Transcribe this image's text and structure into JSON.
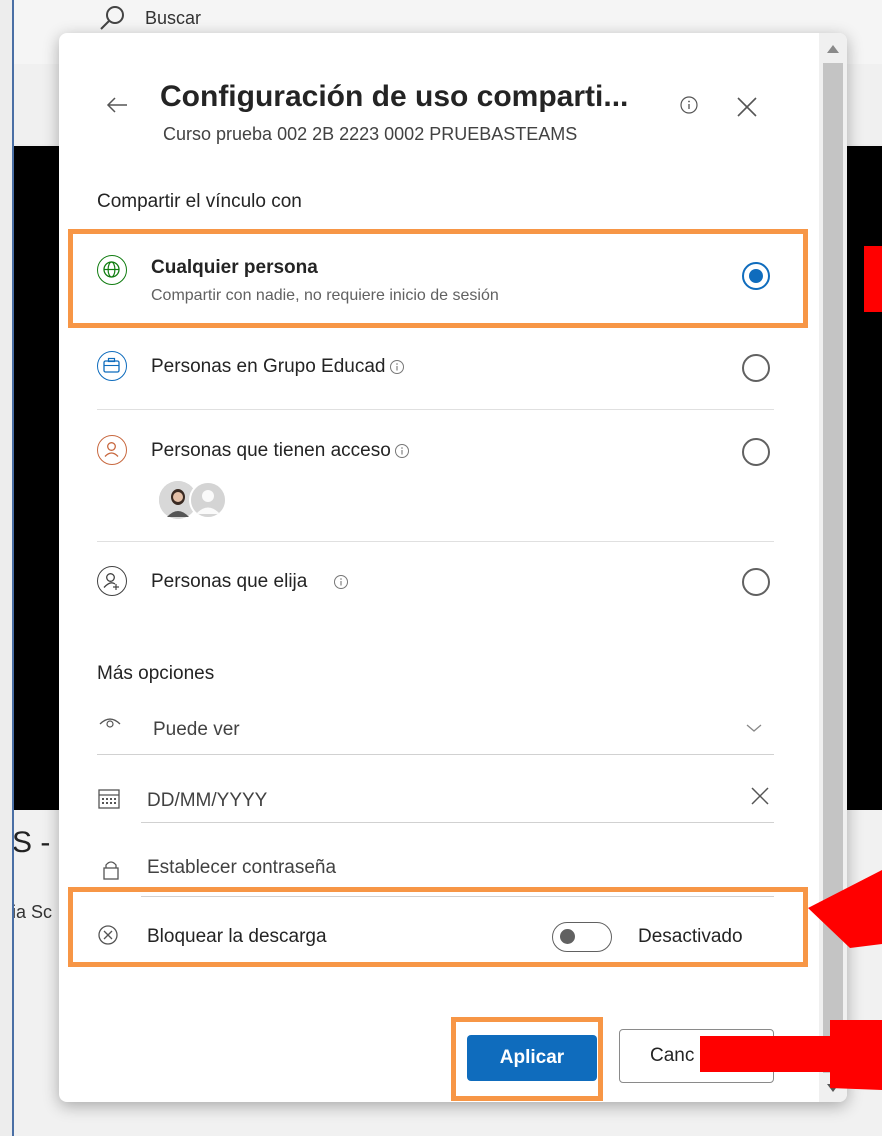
{
  "background": {
    "search_placeholder": "Buscar",
    "partial_title": "S - C",
    "partial_sub": "ia Sc"
  },
  "dialog": {
    "title": "Configuración de uso comparti...",
    "subtitle": "Curso prueba 002 2B 2223 0002 PRUEBASTEAMS",
    "share_section_label": "Compartir el vínculo con",
    "options": [
      {
        "label": "Cualquier persona",
        "description": "Compartir con nadie, no requiere inicio de sesión",
        "selected": true,
        "icon": "globe-icon"
      },
      {
        "label": "Personas en Grupo Educad",
        "selected": false,
        "icon": "briefcase-icon"
      },
      {
        "label": "Personas que tienen acceso",
        "selected": false,
        "icon": "person-icon"
      },
      {
        "label": "Personas que elija",
        "selected": false,
        "icon": "person-add-icon"
      }
    ],
    "more_options_label": "Más opciones",
    "permission": {
      "value": "Puede ver"
    },
    "expiration": {
      "placeholder": "DD/MM/YYYY"
    },
    "password": {
      "placeholder": "Establecer contraseña"
    },
    "block_download": {
      "label": "Bloquear la descarga",
      "state_label": "Desactivado",
      "enabled": false
    },
    "apply_label": "Aplicar",
    "cancel_label": "Cancelar",
    "cancel_visible_label": "Canc"
  },
  "colors": {
    "accent": "#0f6cbd",
    "highlight": "#f79646",
    "annotation": "#ff0000"
  }
}
